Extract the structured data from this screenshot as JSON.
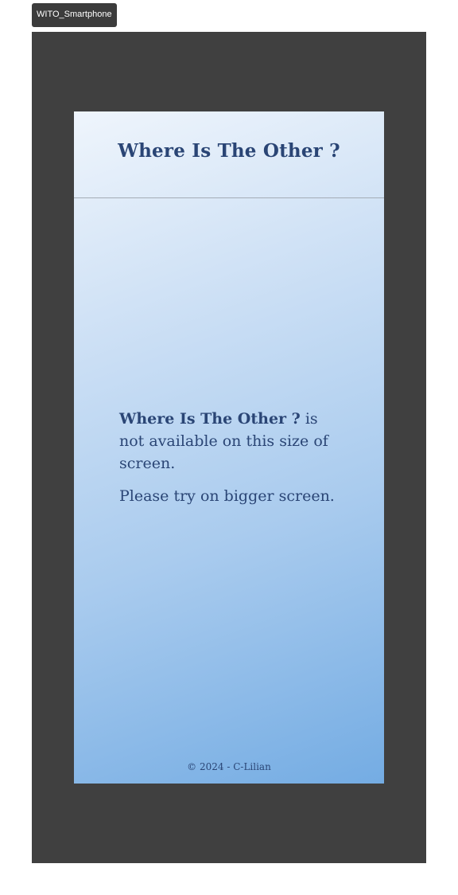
{
  "frame": {
    "label": "WITO_Smartphone"
  },
  "header": {
    "title": "Where Is The Other ?"
  },
  "message": {
    "brand": "Where Is The Other ?",
    "line1_rest": " is not available on this size of screen.",
    "line2": "Please try on bigger screen."
  },
  "footer": {
    "text": "© 2024 - C-Lilian"
  },
  "colors": {
    "frame": "#404040",
    "text": "#2a4575",
    "gradient_start": "#eff5fc",
    "gradient_end": "#74ace3"
  }
}
